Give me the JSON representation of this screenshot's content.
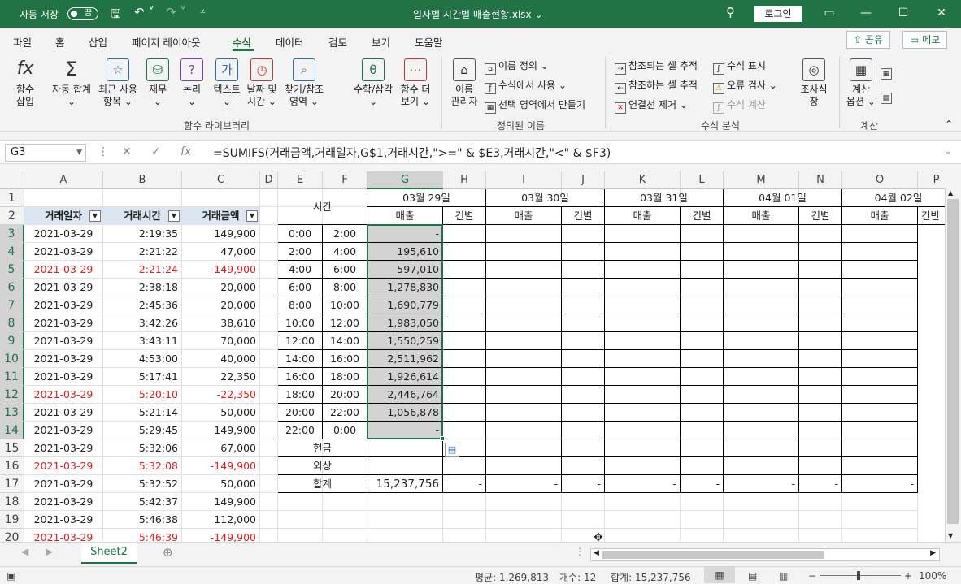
{
  "title_bar": {
    "autosave_label": "자동 저장",
    "autosave_state": "끔",
    "filename": "일자별 시간별 매출현황.xlsx",
    "login_label": "로그인"
  },
  "tabs": [
    "파일",
    "홈",
    "삽입",
    "페이지 레이아웃",
    "수식",
    "데이터",
    "검토",
    "보기",
    "도움말"
  ],
  "active_tab": "수식",
  "share_label": "공유",
  "comment_label": "메모",
  "ribbon": {
    "function_library": {
      "insert_fn": [
        "함수",
        "삽입"
      ],
      "autosum": [
        "자동 합계"
      ],
      "recent": [
        "최근 사용",
        "항목"
      ],
      "finance": [
        "재무"
      ],
      "logic": [
        "논리"
      ],
      "text": [
        "텍스트"
      ],
      "datetime": [
        "날짜 및",
        "시간"
      ],
      "lookup": [
        "찾기/참조",
        "영역"
      ],
      "math": [
        "수학/삼각"
      ],
      "more": [
        "함수 더",
        "보기"
      ],
      "group_label": "함수 라이브러리"
    },
    "defined_names": {
      "name_manager": [
        "이름",
        "관리자"
      ],
      "define_name": "이름 정의",
      "use_in_formula": "수식에서 사용",
      "create_from_selection": "선택 영역에서 만들기",
      "group_label": "정의된 이름"
    },
    "formula_auditing": {
      "trace_precedents": "참조되는 셀 추적",
      "trace_dependents": "참조하는 셀 추적",
      "remove_arrows": "연결선 제거",
      "show_formulas": "수식 표시",
      "error_checking": "오류 검사",
      "evaluate_formula": "수식 계산",
      "watch_window": [
        "조사식",
        "창"
      ],
      "group_label": "수식 분석"
    },
    "calculation": {
      "options": [
        "계산",
        "옵션"
      ],
      "group_label": "계산"
    }
  },
  "formula_bar": {
    "name_box": "G3",
    "formula": "=SUMIFS(거래금액,거래일자,G$1,거래시간,\">=\" & $E3,거래시간,\"<\" & $F3)"
  },
  "columns": [
    "A",
    "B",
    "C",
    "D",
    "E",
    "F",
    "G",
    "H",
    "I",
    "J",
    "K",
    "L",
    "M",
    "N",
    "O",
    "P"
  ],
  "rows": [
    "1",
    "2",
    "3",
    "4",
    "5",
    "6",
    "7",
    "8",
    "9",
    "10",
    "11",
    "12",
    "13",
    "14",
    "15",
    "16",
    "17",
    "18",
    "19",
    "20"
  ],
  "table_headers": [
    "거래일자",
    "거래시간",
    "거래금액"
  ],
  "transactions": [
    {
      "date": "2021-03-29",
      "time": "2:19:35",
      "amount": "149,900",
      "neg": false
    },
    {
      "date": "2021-03-29",
      "time": "2:21:22",
      "amount": "47,000",
      "neg": false
    },
    {
      "date": "2021-03-29",
      "time": "2:21:24",
      "amount": "-149,900",
      "neg": true
    },
    {
      "date": "2021-03-29",
      "time": "2:38:18",
      "amount": "20,000",
      "neg": false
    },
    {
      "date": "2021-03-29",
      "time": "2:45:36",
      "amount": "20,000",
      "neg": false
    },
    {
      "date": "2021-03-29",
      "time": "3:42:26",
      "amount": "38,610",
      "neg": false
    },
    {
      "date": "2021-03-29",
      "time": "3:43:11",
      "amount": "70,000",
      "neg": false
    },
    {
      "date": "2021-03-29",
      "time": "4:53:00",
      "amount": "40,000",
      "neg": false
    },
    {
      "date": "2021-03-29",
      "time": "5:17:41",
      "amount": "22,350",
      "neg": false
    },
    {
      "date": "2021-03-29",
      "time": "5:20:10",
      "amount": "-22,350",
      "neg": true
    },
    {
      "date": "2021-03-29",
      "time": "5:21:14",
      "amount": "50,000",
      "neg": false
    },
    {
      "date": "2021-03-29",
      "time": "5:29:45",
      "amount": "149,900",
      "neg": false
    },
    {
      "date": "2021-03-29",
      "time": "5:32:06",
      "amount": "67,000",
      "neg": false
    },
    {
      "date": "2021-03-29",
      "time": "5:32:08",
      "amount": "-149,900",
      "neg": true
    },
    {
      "date": "2021-03-29",
      "time": "5:32:52",
      "amount": "50,000",
      "neg": false
    },
    {
      "date": "2021-03-29",
      "time": "5:42:37",
      "amount": "149,900",
      "neg": false
    },
    {
      "date": "2021-03-29",
      "time": "5:46:38",
      "amount": "112,000",
      "neg": false
    },
    {
      "date": "2021-03-29",
      "time": "5:46:39",
      "amount": "-149,900",
      "neg": true
    }
  ],
  "summary": {
    "time_label": "시간",
    "dates": [
      "03월 29일",
      "03월 30일",
      "03월 31일",
      "04월 01일",
      "04월 02일"
    ],
    "sales_label": "매출",
    "count_label": "건별",
    "count_label_cut": "건반",
    "slots": [
      {
        "from": "0:00",
        "to": "2:00",
        "sales": "-"
      },
      {
        "from": "2:00",
        "to": "4:00",
        "sales": "195,610"
      },
      {
        "from": "4:00",
        "to": "6:00",
        "sales": "597,010"
      },
      {
        "from": "6:00",
        "to": "8:00",
        "sales": "1,278,830"
      },
      {
        "from": "8:00",
        "to": "10:00",
        "sales": "1,690,779"
      },
      {
        "from": "10:00",
        "to": "12:00",
        "sales": "1,983,050"
      },
      {
        "from": "12:00",
        "to": "14:00",
        "sales": "1,550,259"
      },
      {
        "from": "14:00",
        "to": "16:00",
        "sales": "2,511,962"
      },
      {
        "from": "16:00",
        "to": "18:00",
        "sales": "1,926,614"
      },
      {
        "from": "18:00",
        "to": "20:00",
        "sales": "2,446,764"
      },
      {
        "from": "20:00",
        "to": "22:00",
        "sales": "1,056,878"
      },
      {
        "from": "22:00",
        "to": "0:00",
        "sales": "-"
      }
    ],
    "cash_label": "현금",
    "credit_label": "외상",
    "total_label": "합계",
    "total_value": "15,237,756",
    "dash": "-"
  },
  "sheet_tab": "Sheet2",
  "status": {
    "average": "평균:  1,269,813",
    "count": "개수: 12",
    "sum": "합계:  15,237,756",
    "zoom": "100%"
  }
}
